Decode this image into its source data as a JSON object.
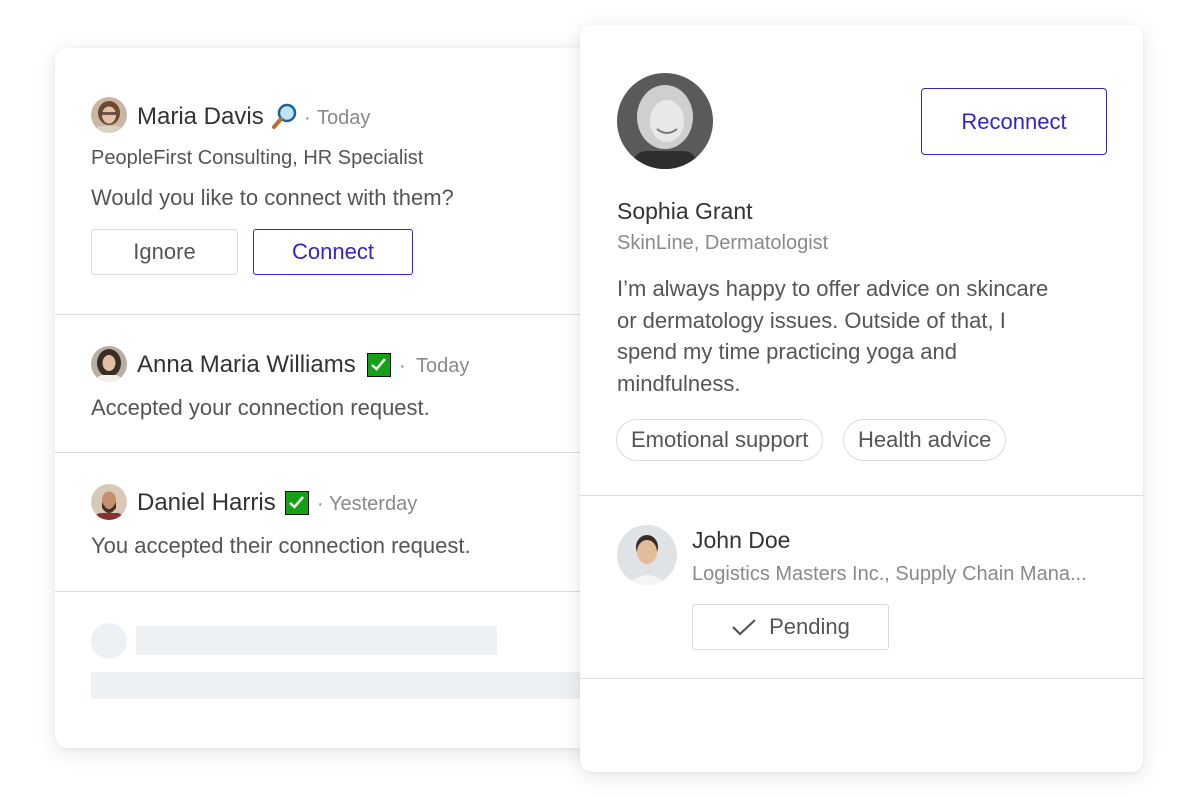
{
  "notifications": [
    {
      "name": "Maria Davis",
      "badge_icon": "magnifier-icon",
      "separator": "·",
      "time": "Today",
      "subtitle": "PeopleFirst Consulting, HR Specialist",
      "message": "Would you like to connect with them?",
      "ignore_label": "Ignore",
      "connect_label": "Connect"
    },
    {
      "name": "Anna Maria Williams",
      "badge_icon": "checkmark-icon",
      "separator": "·",
      "time": "Today",
      "message": "Accepted your connection request."
    },
    {
      "name": "Daniel Harris",
      "badge_icon": "checkmark-icon",
      "separator": "·",
      "time": "Yesterday",
      "message": "You accepted their connection request."
    }
  ],
  "profile": {
    "name": "Sophia Grant",
    "subtitle": "SkinLine, Dermatologist",
    "bio_lines": [
      "I’m always happy to offer advice on skincare",
      "or dermatology issues. Outside of that, I",
      "spend my time practicing yoga and",
      "mindfulness."
    ],
    "tags": [
      "Emotional support",
      "Health advice"
    ],
    "reconnect_label": "Reconnect"
  },
  "suggestion": {
    "name": "John Doe",
    "subtitle": "Logistics Masters Inc., Supply Chain Mana...",
    "pending_label": "Pending",
    "pending_icon": "checkmark-icon"
  },
  "colors": {
    "accent": "#3325c7",
    "verified_green": "#14a214",
    "border": "#dcdcdc",
    "skeleton": "#eef1f4"
  }
}
